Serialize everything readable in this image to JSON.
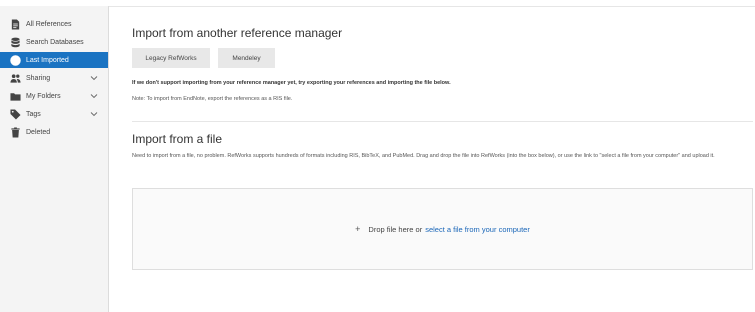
{
  "sidebar": {
    "items": [
      {
        "label": "All References",
        "icon": "document-icon"
      },
      {
        "label": "Search Databases",
        "icon": "database-icon"
      },
      {
        "label": "Last Imported",
        "icon": "clock-icon",
        "active": true
      },
      {
        "label": "Sharing",
        "icon": "users-icon",
        "expandable": true
      },
      {
        "label": "My Folders",
        "icon": "folder-icon",
        "expandable": true
      },
      {
        "label": "Tags",
        "icon": "tag-icon",
        "expandable": true
      },
      {
        "label": "Deleted",
        "icon": "trash-icon"
      }
    ]
  },
  "main": {
    "import_manager": {
      "title": "Import from another reference manager",
      "buttons": [
        "Legacy RefWorks",
        "Mendeley"
      ],
      "note_bold": "If we don't support importing from your reference manager yet, try exporting your references and importing the file below.",
      "note": "Note: To import from EndNote, export the references as a RIS file."
    },
    "import_file": {
      "title": "Import from a file",
      "description": "Need to import from a file, no problem. RefWorks supports hundreds of formats including RIS, BibTeX, and PubMed. Drag and drop the file into RefWorks (into the box below), or use the link to \"select a file from your computer\" and upload it.",
      "drop_text": "Drop file here or",
      "drop_link": "select a file from your computer"
    }
  },
  "colors": {
    "accent": "#1a73c2",
    "link": "#1a66b8",
    "sidebar_bg": "#f4f4f4",
    "button_bg": "#e8e8e8"
  }
}
